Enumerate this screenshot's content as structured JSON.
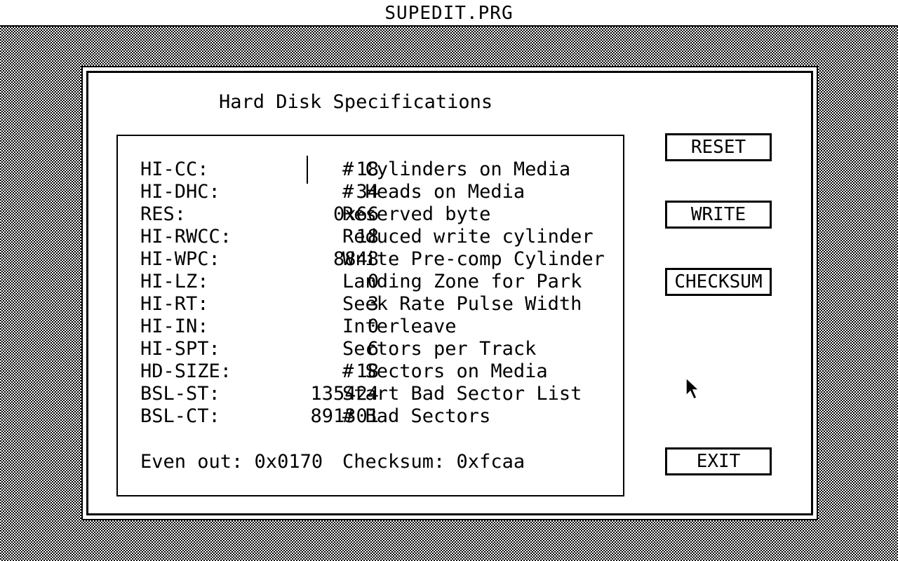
{
  "app": {
    "title": "SUPEDIT.PRG"
  },
  "dialog": {
    "title": "Hard Disk Specifications"
  },
  "specs": [
    {
      "label": "HI-CC:",
      "value": "18",
      "desc": "# Cylinders on Media"
    },
    {
      "label": "HI-DHC:",
      "value": "34",
      "desc": "# Heads on Media"
    },
    {
      "label": "RES:",
      "value": "0x66",
      "desc": "Reserved byte"
    },
    {
      "label": "HI-RWCC:",
      "value": "18",
      "desc": "Reduced write cylinder"
    },
    {
      "label": "HI-WPC:",
      "value": "8848",
      "desc": "Write Pre-comp Cylinder"
    },
    {
      "label": "HI-LZ:",
      "value": "0",
      "desc": "Landing Zone for Park"
    },
    {
      "label": "HI-RT:",
      "value": "3",
      "desc": "Seek Rate Pulse Width"
    },
    {
      "label": "HI-IN:",
      "value": "0",
      "desc": "Interleave"
    },
    {
      "label": "HI-SPT:",
      "value": "6",
      "desc": "Sectors per Track"
    },
    {
      "label": "HD-SIZE:",
      "value": "18",
      "desc": "# Sectors on Media"
    },
    {
      "label": "BSL-ST:",
      "value": "135424",
      "desc": "Start Bad Sector List"
    },
    {
      "label": "BSL-CT:",
      "value": "891301",
      "desc": "# Bad Sectors"
    }
  ],
  "footer": {
    "even_out": "Even out: 0x0170",
    "checksum": "Checksum: 0xfcaa"
  },
  "buttons": {
    "reset": "RESET",
    "write": "WRITE",
    "checksum": "CHECKSUM",
    "exit": "EXIT"
  },
  "icons": {
    "pointer": "mouse-pointer-icon"
  },
  "colors": {
    "foreground": "#000000",
    "background": "#ffffff"
  }
}
